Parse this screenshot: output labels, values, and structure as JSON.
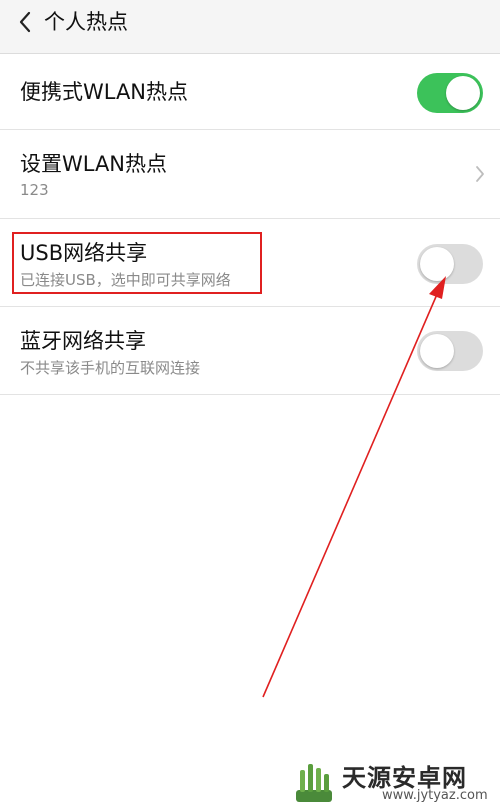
{
  "header": {
    "title": "个人热点"
  },
  "settings": {
    "wlan_hotspot": {
      "title": "便携式WLAN热点",
      "enabled": true
    },
    "wlan_setup": {
      "title": "设置WLAN热点",
      "subtitle": "123"
    },
    "usb_tethering": {
      "title": "USB网络共享",
      "subtitle": "已连接USB，选中即可共享网络",
      "enabled": false
    },
    "bluetooth_tethering": {
      "title": "蓝牙网络共享",
      "subtitle": "不共享该手机的互联网连接",
      "enabled": false
    }
  },
  "colors": {
    "toggle_on": "#3cc25a",
    "toggle_off": "#dcdcdc",
    "annotation": "#e02020"
  },
  "icons": {
    "back": "chevron-left-icon",
    "chevron": "chevron-right-icon"
  },
  "watermark": {
    "title": "天源安卓网",
    "url": "www.jytyaz.com"
  }
}
